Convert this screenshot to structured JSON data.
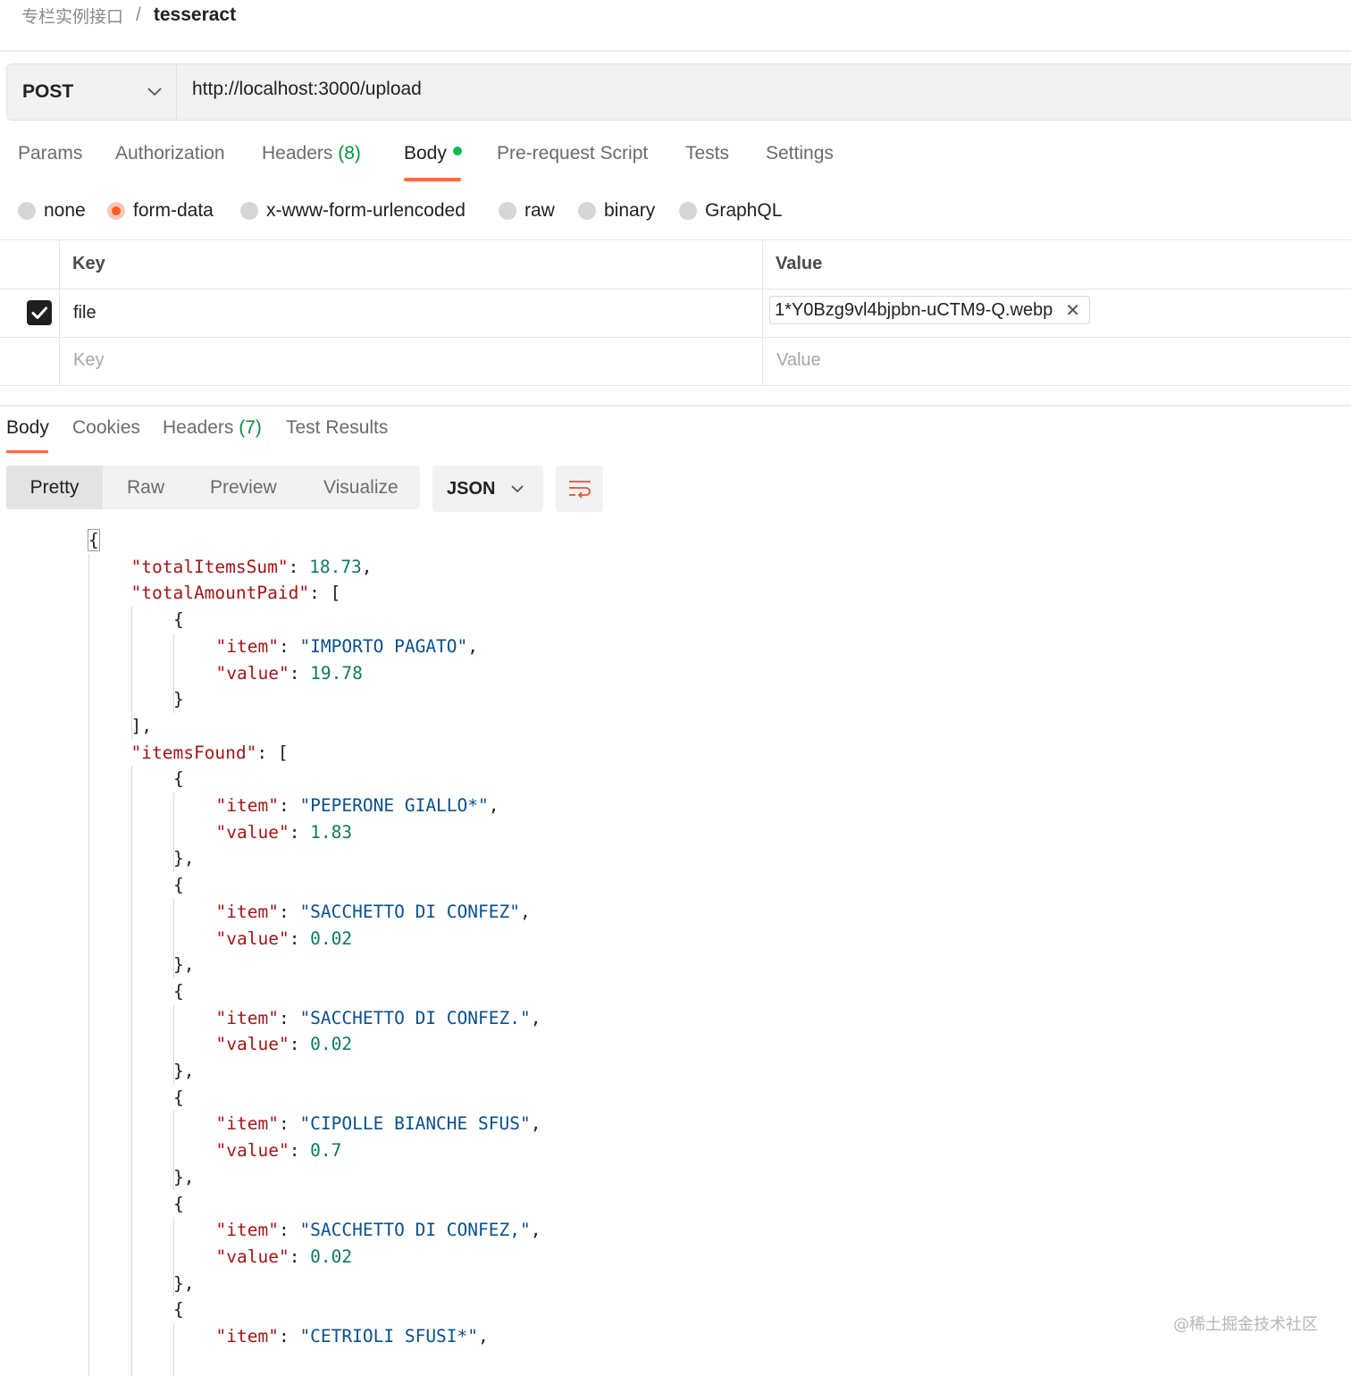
{
  "breadcrumb": {
    "parent": "专栏实例接口",
    "separator": "/",
    "current": "tesseract"
  },
  "request": {
    "method": "POST",
    "url": "http://localhost:3000/upload"
  },
  "request_tabs": {
    "params": "Params",
    "authorization": "Authorization",
    "headers": "Headers",
    "headers_count": "(8)",
    "body": "Body",
    "pre_request": "Pre-request Script",
    "tests": "Tests",
    "settings": "Settings"
  },
  "body_types": {
    "none": "none",
    "form_data": "form-data",
    "urlencoded": "x-www-form-urlencoded",
    "raw": "raw",
    "binary": "binary",
    "graphql": "GraphQL",
    "selected": "form-data"
  },
  "form_table": {
    "key_header": "Key",
    "value_header": "Value",
    "rows": [
      {
        "checked": true,
        "key": "file",
        "value": "1*Y0Bzg9vl4bjpbn-uCTM9-Q.webp"
      }
    ],
    "key_placeholder": "Key",
    "value_placeholder": "Value"
  },
  "response_tabs": {
    "body": "Body",
    "cookies": "Cookies",
    "headers": "Headers",
    "headers_count": "(7)",
    "test_results": "Test Results"
  },
  "view_modes": {
    "pretty": "Pretty",
    "raw": "Raw",
    "preview": "Preview",
    "visualize": "Visualize"
  },
  "format": "JSON",
  "watermark": "@稀土掘金技术社区",
  "colors": {
    "accent": "#ff6c37",
    "body_dot": "#0cbb52",
    "count_green": "#0b8f3f",
    "json_key": "#a31515",
    "json_string": "#0b4f8a",
    "json_number": "#0e7a5a",
    "line_number": "#1a5f8c"
  },
  "code_lines": [
    {
      "n": "1",
      "i": 0,
      "t": [
        [
          "p",
          "{"
        ]
      ]
    },
    {
      "n": "2",
      "i": 1,
      "t": [
        [
          "k",
          "\"totalItemsSum\""
        ],
        [
          "p",
          ": "
        ],
        [
          "n",
          "18.73"
        ],
        [
          "p",
          ","
        ]
      ]
    },
    {
      "n": "3",
      "i": 1,
      "t": [
        [
          "k",
          "\"totalAmountPaid\""
        ],
        [
          "p",
          ": ["
        ]
      ]
    },
    {
      "n": "4",
      "i": 2,
      "t": [
        [
          "p",
          "{"
        ]
      ]
    },
    {
      "n": "5",
      "i": 3,
      "t": [
        [
          "k",
          "\"item\""
        ],
        [
          "p",
          ": "
        ],
        [
          "s",
          "\"IMPORTO PAGATO\""
        ],
        [
          "p",
          ","
        ]
      ]
    },
    {
      "n": "6",
      "i": 3,
      "t": [
        [
          "k",
          "\"value\""
        ],
        [
          "p",
          ": "
        ],
        [
          "n",
          "19.78"
        ]
      ]
    },
    {
      "n": "7",
      "i": 2,
      "t": [
        [
          "p",
          "}"
        ]
      ]
    },
    {
      "n": "8",
      "i": 1,
      "t": [
        [
          "p",
          "],"
        ]
      ]
    },
    {
      "n": "9",
      "i": 1,
      "t": [
        [
          "k",
          "\"itemsFound\""
        ],
        [
          "p",
          ": ["
        ]
      ]
    },
    {
      "n": "10",
      "i": 2,
      "t": [
        [
          "p",
          "{"
        ]
      ]
    },
    {
      "n": "11",
      "i": 3,
      "t": [
        [
          "k",
          "\"item\""
        ],
        [
          "p",
          ": "
        ],
        [
          "s",
          "\"PEPERONE GIALLO*\""
        ],
        [
          "p",
          ","
        ]
      ]
    },
    {
      "n": "12",
      "i": 3,
      "t": [
        [
          "k",
          "\"value\""
        ],
        [
          "p",
          ": "
        ],
        [
          "n",
          "1.83"
        ]
      ]
    },
    {
      "n": "13",
      "i": 2,
      "t": [
        [
          "p",
          "},"
        ]
      ]
    },
    {
      "n": "14",
      "i": 2,
      "t": [
        [
          "p",
          "{"
        ]
      ]
    },
    {
      "n": "15",
      "i": 3,
      "t": [
        [
          "k",
          "\"item\""
        ],
        [
          "p",
          ": "
        ],
        [
          "s",
          "\"SACCHETTO DI CONFEZ\""
        ],
        [
          "p",
          ","
        ]
      ]
    },
    {
      "n": "16",
      "i": 3,
      "t": [
        [
          "k",
          "\"value\""
        ],
        [
          "p",
          ": "
        ],
        [
          "n",
          "0.02"
        ]
      ]
    },
    {
      "n": "17",
      "i": 2,
      "t": [
        [
          "p",
          "},"
        ]
      ]
    },
    {
      "n": "18",
      "i": 2,
      "t": [
        [
          "p",
          "{"
        ]
      ]
    },
    {
      "n": "19",
      "i": 3,
      "t": [
        [
          "k",
          "\"item\""
        ],
        [
          "p",
          ": "
        ],
        [
          "s",
          "\"SACCHETTO DI CONFEZ.\""
        ],
        [
          "p",
          ","
        ]
      ]
    },
    {
      "n": "20",
      "i": 3,
      "t": [
        [
          "k",
          "\"value\""
        ],
        [
          "p",
          ": "
        ],
        [
          "n",
          "0.02"
        ]
      ]
    },
    {
      "n": "21",
      "i": 2,
      "t": [
        [
          "p",
          "},"
        ]
      ]
    },
    {
      "n": "22",
      "i": 2,
      "t": [
        [
          "p",
          "{"
        ]
      ]
    },
    {
      "n": "23",
      "i": 3,
      "t": [
        [
          "k",
          "\"item\""
        ],
        [
          "p",
          ": "
        ],
        [
          "s",
          "\"CIPOLLE BIANCHE SFUS\""
        ],
        [
          "p",
          ","
        ]
      ]
    },
    {
      "n": "24",
      "i": 3,
      "t": [
        [
          "k",
          "\"value\""
        ],
        [
          "p",
          ": "
        ],
        [
          "n",
          "0.7"
        ]
      ]
    },
    {
      "n": "25",
      "i": 2,
      "t": [
        [
          "p",
          "},"
        ]
      ]
    },
    {
      "n": "26",
      "i": 2,
      "t": [
        [
          "p",
          "{"
        ]
      ]
    },
    {
      "n": "27",
      "i": 3,
      "t": [
        [
          "k",
          "\"item\""
        ],
        [
          "p",
          ": "
        ],
        [
          "s",
          "\"SACCHETTO DI CONFEZ,\""
        ],
        [
          "p",
          ","
        ]
      ]
    },
    {
      "n": "28",
      "i": 3,
      "t": [
        [
          "k",
          "\"value\""
        ],
        [
          "p",
          ": "
        ],
        [
          "n",
          "0.02"
        ]
      ]
    },
    {
      "n": "29",
      "i": 2,
      "t": [
        [
          "p",
          "},"
        ]
      ]
    },
    {
      "n": "30",
      "i": 2,
      "t": [
        [
          "p",
          "{"
        ]
      ]
    },
    {
      "n": "31",
      "i": 3,
      "t": [
        [
          "k",
          "\"item\""
        ],
        [
          "p",
          ": "
        ],
        [
          "s",
          "\"CETRIOLI SFUSI*\""
        ],
        [
          "p",
          ","
        ]
      ]
    }
  ]
}
